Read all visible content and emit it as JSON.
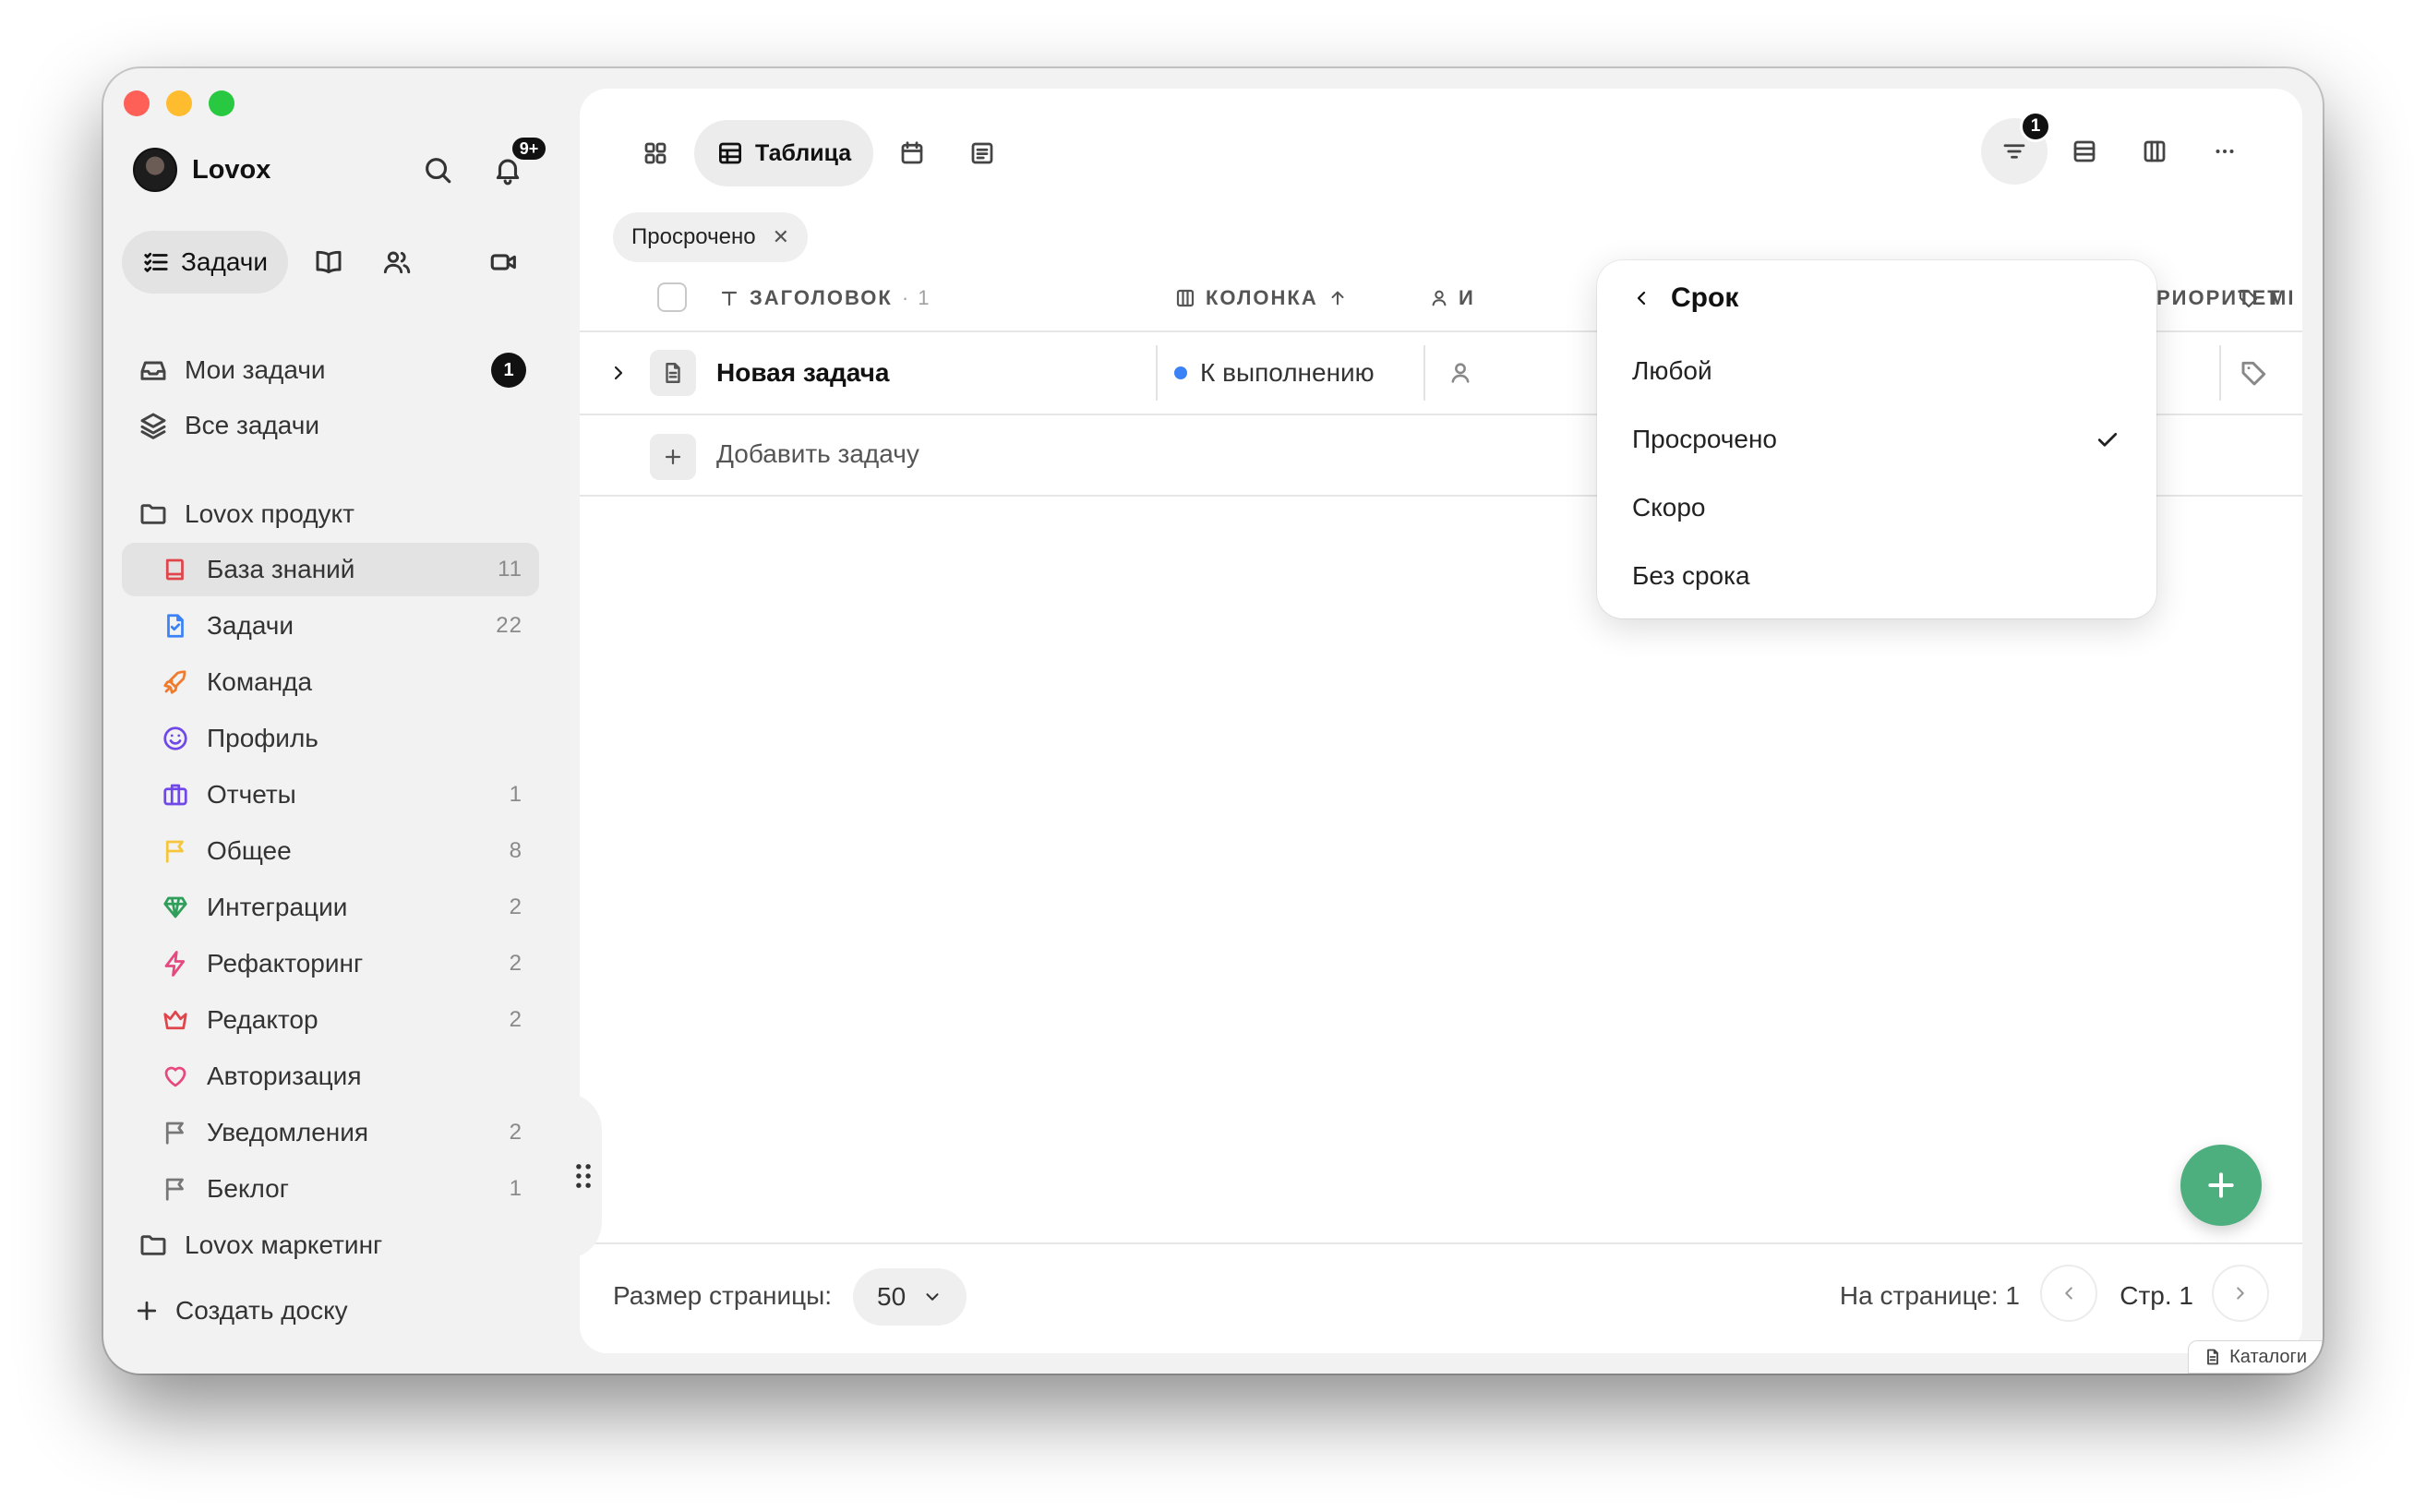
{
  "window": {
    "traffic_lights": [
      "close",
      "minimize",
      "maximize"
    ]
  },
  "sidebar": {
    "user_name": "Lovox",
    "notifications_badge": "9+",
    "tabs": {
      "active_label": "Задачи"
    },
    "my_tasks": {
      "label": "Мои задачи",
      "badge": "1"
    },
    "all_tasks": {
      "label": "Все задачи"
    },
    "workspaces": [
      {
        "label": "Lovox продукт"
      },
      {
        "label": "Lovox маркетинг"
      }
    ],
    "boards": [
      {
        "label": "База знаний",
        "count": "11",
        "icon": "book-icon",
        "color": "#e0454b"
      },
      {
        "label": "Задачи",
        "count": "22",
        "icon": "doc-check-icon",
        "color": "#3b82f6"
      },
      {
        "label": "Команда",
        "count": "",
        "icon": "rocket-icon",
        "color": "#f07b2e"
      },
      {
        "label": "Профиль",
        "count": "",
        "icon": "smile-icon",
        "color": "#7048e8"
      },
      {
        "label": "Отчеты",
        "count": "1",
        "icon": "briefcase-icon",
        "color": "#7048e8"
      },
      {
        "label": "Общее",
        "count": "8",
        "icon": "flag-icon",
        "color": "#f5c63c"
      },
      {
        "label": "Интеграции",
        "count": "2",
        "icon": "diamond-icon",
        "color": "#2f9e5b"
      },
      {
        "label": "Рефакторинг",
        "count": "2",
        "icon": "bolt-icon",
        "color": "#e64980"
      },
      {
        "label": "Редактор",
        "count": "2",
        "icon": "crown-icon",
        "color": "#e0454b"
      },
      {
        "label": "Авторизация",
        "count": "",
        "icon": "heart-icon",
        "color": "#e64980"
      },
      {
        "label": "Уведомления",
        "count": "2",
        "icon": "flag-icon",
        "color": "#777777"
      },
      {
        "label": "Беклог",
        "count": "1",
        "icon": "flag-icon",
        "color": "#777777"
      }
    ],
    "create_board": "Создать доску"
  },
  "toolbar": {
    "table_view_label": "Таблица",
    "filter_badge": "1"
  },
  "filter_chip": {
    "label": "Просрочено"
  },
  "table": {
    "headers": {
      "title": "ЗАГОЛОВОК",
      "title_count": "· 1",
      "column": "КОЛОНКА",
      "assignee": "И",
      "priority": "РИОРИТЕТ",
      "tags": "МІ"
    },
    "rows": [
      {
        "title": "Новая задача",
        "status": "К выполнению",
        "status_color": "#3b82f6"
      }
    ],
    "add_task": "Добавить задачу"
  },
  "dropdown": {
    "title": "Срок",
    "options": [
      {
        "label": "Любой",
        "selected": false
      },
      {
        "label": "Просрочено",
        "selected": true
      },
      {
        "label": "Скоро",
        "selected": false
      },
      {
        "label": "Без срока",
        "selected": false
      }
    ]
  },
  "footer": {
    "page_size_label": "Размер страницы:",
    "page_size_value": "50",
    "on_page": "На странице: 1",
    "page": "Стр. 1"
  },
  "catalog_label": "Каталоги",
  "colors": {
    "fab": "#4caf7d",
    "accent_blue": "#3b82f6"
  }
}
